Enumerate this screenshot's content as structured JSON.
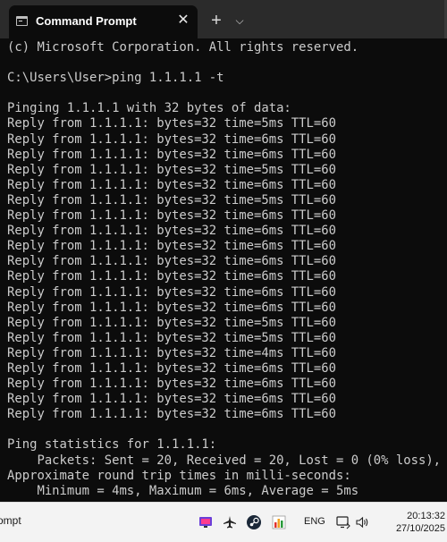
{
  "window": {
    "tab_title": "Command Prompt",
    "close_glyph": "✕",
    "new_tab_glyph": "+",
    "dropdown_glyph": "⌵"
  },
  "terminal": {
    "foreground": "#cccccc",
    "background": "#0c0c0c",
    "lines": [
      "(c) Microsoft Corporation. All rights reserved.",
      "",
      "C:\\Users\\User>ping 1.1.1.1 -t",
      "",
      "Pinging 1.1.1.1 with 32 bytes of data:",
      "Reply from 1.1.1.1: bytes=32 time=5ms TTL=60",
      "Reply from 1.1.1.1: bytes=32 time=6ms TTL=60",
      "Reply from 1.1.1.1: bytes=32 time=6ms TTL=60",
      "Reply from 1.1.1.1: bytes=32 time=5ms TTL=60",
      "Reply from 1.1.1.1: bytes=32 time=6ms TTL=60",
      "Reply from 1.1.1.1: bytes=32 time=5ms TTL=60",
      "Reply from 1.1.1.1: bytes=32 time=6ms TTL=60",
      "Reply from 1.1.1.1: bytes=32 time=6ms TTL=60",
      "Reply from 1.1.1.1: bytes=32 time=6ms TTL=60",
      "Reply from 1.1.1.1: bytes=32 time=6ms TTL=60",
      "Reply from 1.1.1.1: bytes=32 time=6ms TTL=60",
      "Reply from 1.1.1.1: bytes=32 time=6ms TTL=60",
      "Reply from 1.1.1.1: bytes=32 time=6ms TTL=60",
      "Reply from 1.1.1.1: bytes=32 time=5ms TTL=60",
      "Reply from 1.1.1.1: bytes=32 time=5ms TTL=60",
      "Reply from 1.1.1.1: bytes=32 time=4ms TTL=60",
      "Reply from 1.1.1.1: bytes=32 time=6ms TTL=60",
      "Reply from 1.1.1.1: bytes=32 time=6ms TTL=60",
      "Reply from 1.1.1.1: bytes=32 time=6ms TTL=60",
      "Reply from 1.1.1.1: bytes=32 time=6ms TTL=60",
      "",
      "Ping statistics for 1.1.1.1:",
      "    Packets: Sent = 20, Received = 20, Lost = 0 (0% loss),",
      "Approximate round trip times in milli-seconds:",
      "    Minimum = 4ms, Maximum = 6ms, Average = 5ms"
    ]
  },
  "taskbar": {
    "app_label": "ompt",
    "language": "ENG",
    "time": "20:13:32",
    "date": "27/10/2025",
    "icons": [
      "monitor-icon",
      "airplane-icon",
      "steam-icon",
      "chart-app-icon",
      "display-icon",
      "speaker-icon"
    ]
  }
}
